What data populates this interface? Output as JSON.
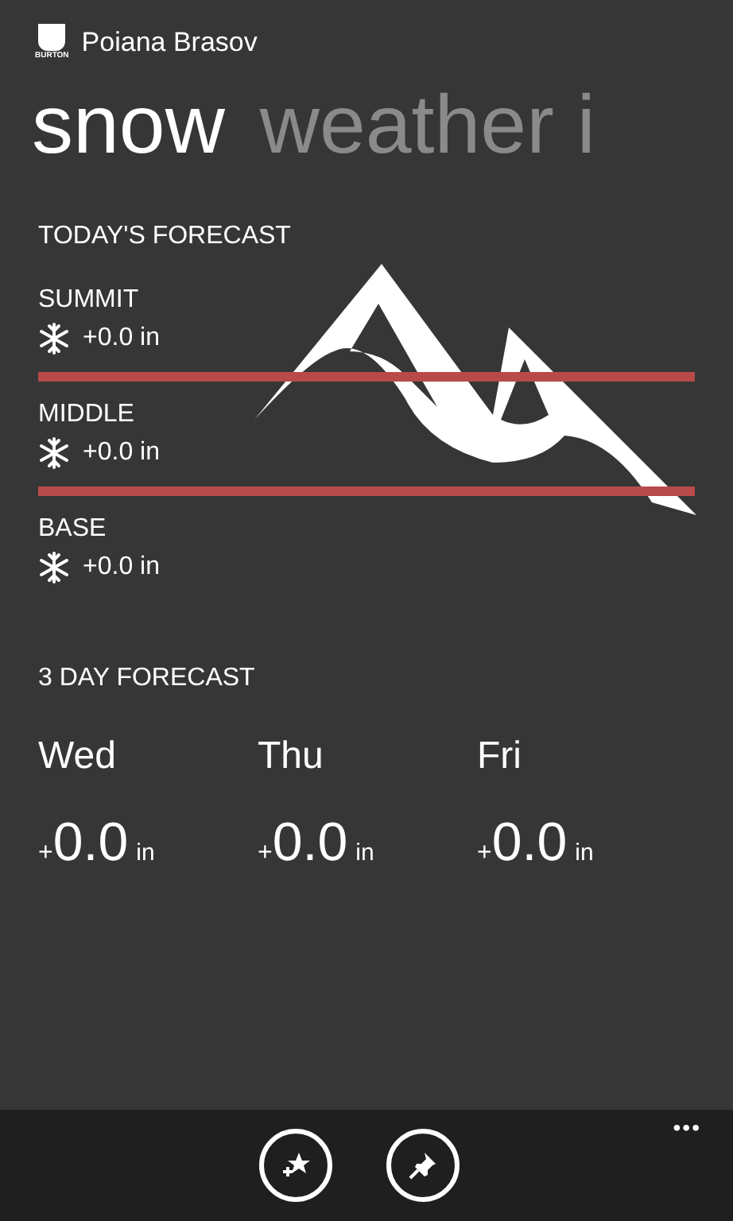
{
  "app": {
    "logo_text": "BURTON",
    "location": "Poiana Brasov"
  },
  "pivot": [
    {
      "label": "snow",
      "selected": true
    },
    {
      "label": "weather i",
      "selected": false
    }
  ],
  "todays_forecast": {
    "title": "TODAY'S FORECAST",
    "levels": [
      {
        "name": "SUMMIT",
        "amount": "+0.0 in"
      },
      {
        "name": "MIDDLE",
        "amount": "+0.0 in"
      },
      {
        "name": "BASE",
        "amount": "+0.0 in"
      }
    ]
  },
  "three_day_forecast": {
    "title": "3 DAY FORECAST",
    "days": [
      {
        "day": "Wed",
        "sign": "+",
        "amount": "0.0",
        "unit": "in"
      },
      {
        "day": "Thu",
        "sign": "+",
        "amount": "0.0",
        "unit": "in"
      },
      {
        "day": "Fri",
        "sign": "+",
        "amount": "0.0",
        "unit": "in"
      }
    ]
  },
  "app_bar": {
    "buttons": [
      {
        "kind": "favorite"
      },
      {
        "kind": "pin"
      }
    ],
    "more": "•••"
  }
}
